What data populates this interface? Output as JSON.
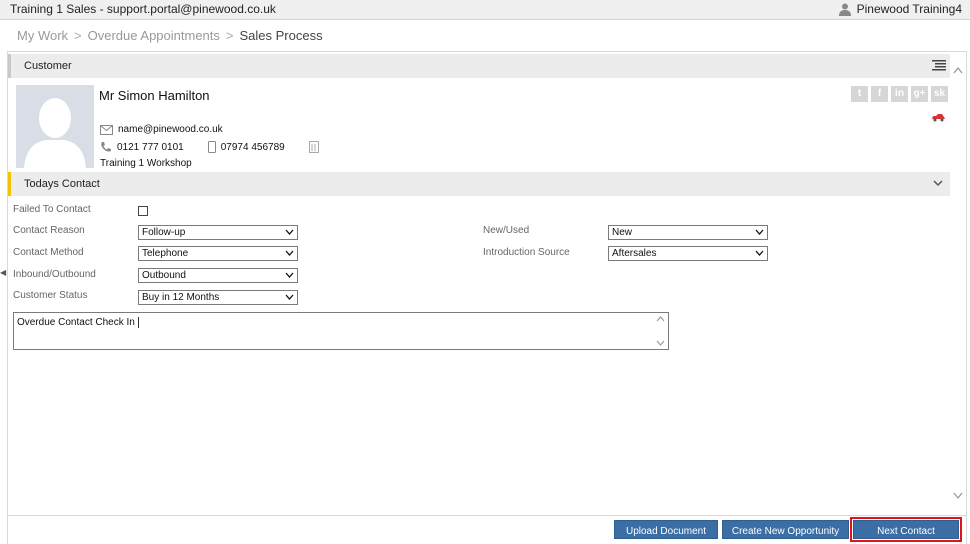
{
  "window": {
    "title": "Training 1 Sales - support.portal@pinewood.co.uk",
    "user": "Pinewood Training4"
  },
  "breadcrumb": {
    "items": [
      "My Work",
      "Overdue Appointments"
    ],
    "current": "Sales Process"
  },
  "customer": {
    "header": "Customer",
    "name": "Mr Simon Hamilton",
    "email": "name@pinewood.co.uk",
    "phone": "0121 777 0101",
    "mobile": "07974 456789",
    "workshop": "Training 1 Workshop",
    "social": [
      "t",
      "f",
      "in",
      "g+",
      "sk"
    ]
  },
  "todays_contact": {
    "header": "Todays Contact",
    "failed_to_contact_label": "Failed To Contact",
    "contact_reason_label": "Contact Reason",
    "contact_reason_value": "Follow-up",
    "contact_method_label": "Contact Method",
    "contact_method_value": "Telephone",
    "inbound_outbound_label": "Inbound/Outbound",
    "inbound_outbound_value": "Outbound",
    "customer_status_label": "Customer Status",
    "customer_status_value": "Buy in 12 Months",
    "new_used_label": "New/Used",
    "new_used_value": "New",
    "introduction_source_label": "Introduction Source",
    "introduction_source_value": "Aftersales",
    "notes_value": "Overdue Contact Check In"
  },
  "actions": {
    "upload": "Upload Document",
    "create_opportunity": "Create New Opportunity",
    "next_contact": "Next Contact"
  },
  "colors": {
    "button": "#3a6ea5",
    "highlight": "#e0141c",
    "contact_accent": "#f2c200"
  }
}
